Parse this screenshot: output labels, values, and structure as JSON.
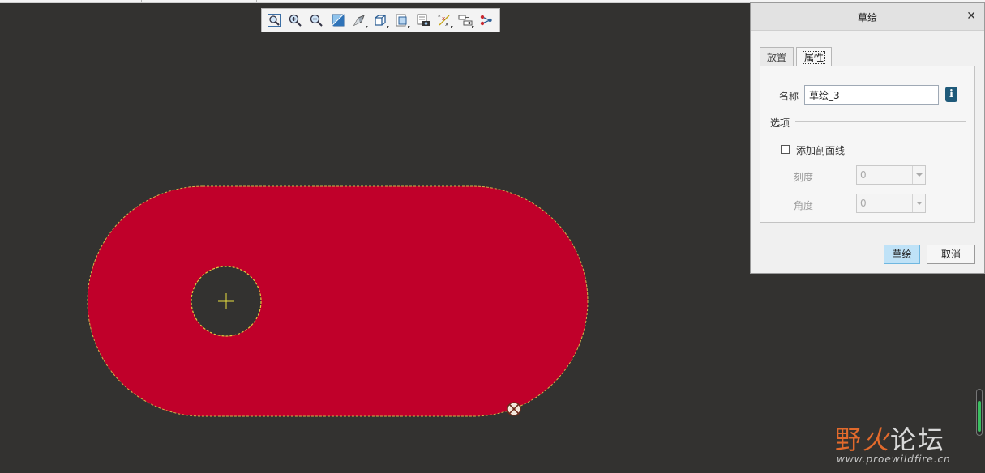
{
  "toolbar": {
    "items": [
      {
        "icon": "refit-zoom-icon"
      },
      {
        "icon": "zoom-in-icon"
      },
      {
        "icon": "zoom-out-icon"
      },
      {
        "icon": "repaint-icon"
      },
      {
        "icon": "display-style-icon"
      },
      {
        "icon": "saved-orientations-icon"
      },
      {
        "icon": "view-manager-icon"
      },
      {
        "icon": "perspective-view-icon"
      },
      {
        "icon": "datum-display-filters-icon"
      },
      {
        "icon": "sketch-display-filters-icon"
      },
      {
        "icon": "annotation-display-icon"
      }
    ]
  },
  "sketch": {
    "fill_color": "#c0002a",
    "hole_outline_color": "#e0c840",
    "center_mark_color": "#e8e040"
  },
  "dialog": {
    "title": "草绘",
    "tabs": [
      {
        "label": "放置",
        "active": false
      },
      {
        "label": "属性",
        "active": true
      }
    ],
    "name_label": "名称",
    "name_value": "草绘_3",
    "options_label": "选项",
    "hatch_checkbox_label": "添加剖面线",
    "hatch_checked": false,
    "scale_label": "刻度",
    "scale_value": "0",
    "angle_label": "角度",
    "angle_value": "0",
    "ok_button": "草绘",
    "cancel_button": "取消"
  },
  "watermark": {
    "char1": "野",
    "char2": "火",
    "char3": "论坛",
    "url": "www.proewildfire.cn"
  }
}
